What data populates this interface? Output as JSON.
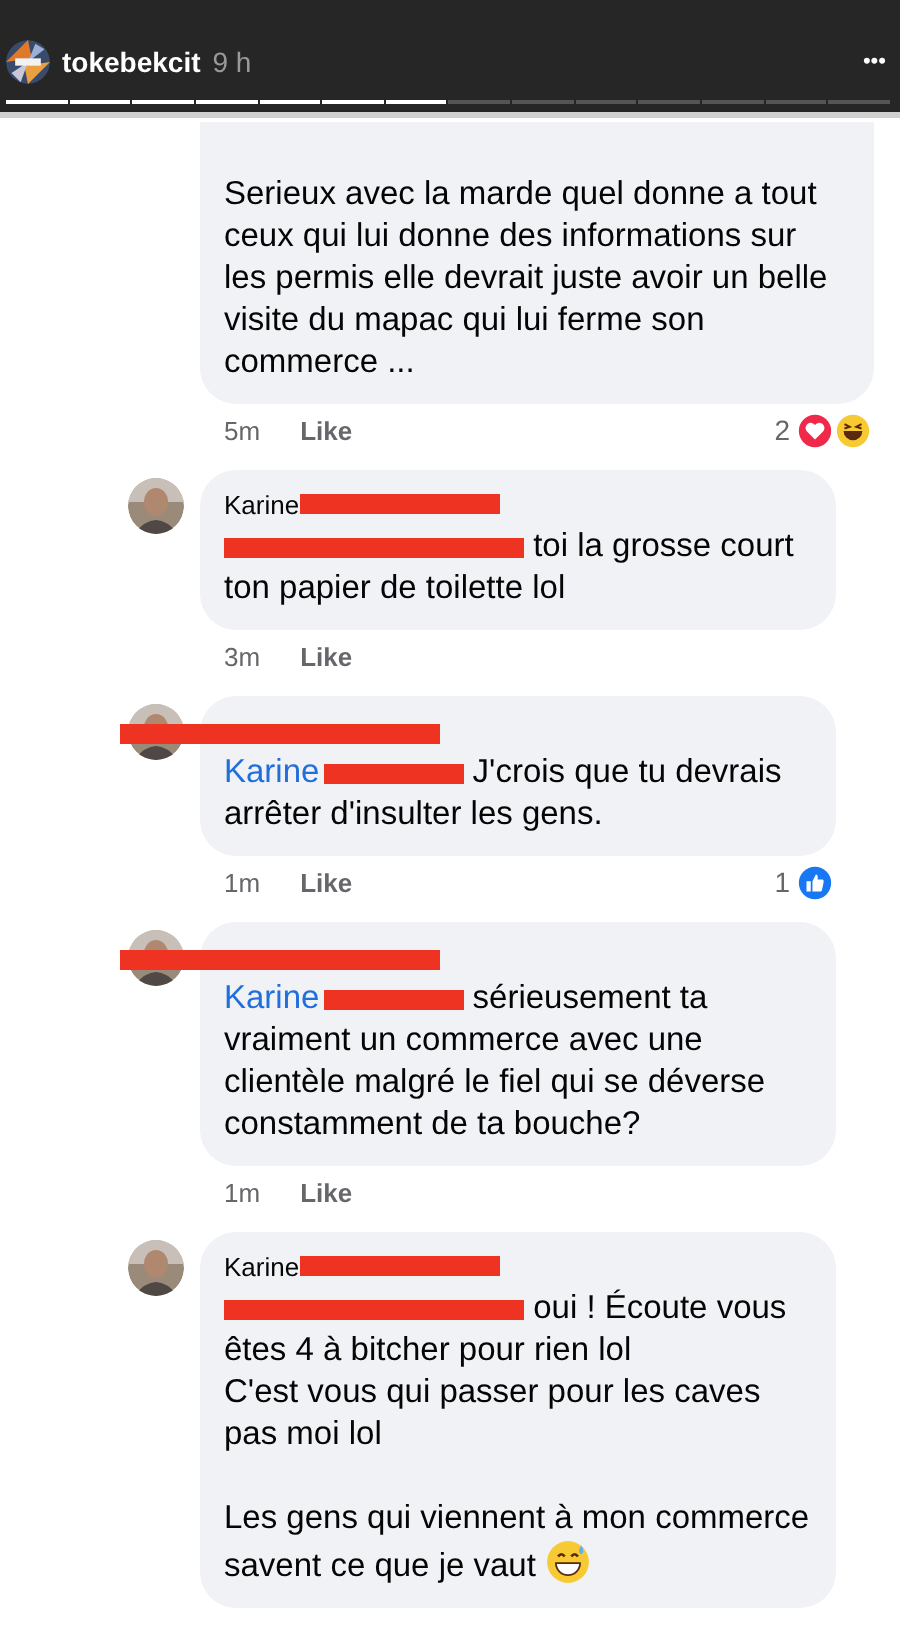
{
  "story_header": {
    "username": "tokebekcit",
    "time": "9 h",
    "menu": "•••",
    "progress": [
      {
        "level": 1
      },
      {
        "level": 1
      },
      {
        "level": 1
      },
      {
        "level": 1
      },
      {
        "level": 1
      },
      {
        "level": 1
      },
      {
        "level": 1
      },
      {
        "level": 0
      },
      {
        "level": 0
      },
      {
        "level": 0
      },
      {
        "level": 0
      },
      {
        "level": 0
      },
      {
        "level": 0
      },
      {
        "level": 0
      }
    ]
  },
  "comments": [
    {
      "avatar": false,
      "text": "Serieux avec la marde quel donne a tout ceux qui lui donne des informations sur les permis elle devrait juste avoir un belle visite du mapac qui lui ferme son commerce ...",
      "time": "5m",
      "like": "Like",
      "reactions": {
        "count": "2",
        "icons": [
          {
            "kind": "love"
          },
          {
            "kind": "haha"
          }
        ]
      }
    },
    {
      "avatar": true,
      "author": {
        "text": "Karine",
        "redacted": true
      },
      "mention": {
        "redacted": true
      },
      "text": "toi la grosse court ton papier de toilette lol",
      "time": "3m",
      "like": "Like"
    },
    {
      "avatar": true,
      "author": {
        "redacted": true
      },
      "mention": {
        "text": "Karine",
        "redacted": true
      },
      "text": "J'crois que tu devrais arrêter d'insulter les gens.",
      "time": "1m",
      "like": "Like",
      "reactions": {
        "count": "1",
        "icons": [
          {
            "kind": "like"
          }
        ]
      }
    },
    {
      "avatar": true,
      "author": {
        "redacted": true
      },
      "mention": {
        "text": "Karine",
        "redacted": true
      },
      "text": "sérieusement ta vraiment un commerce avec une clientèle malgré le fiel qui se déverse constamment de ta bouche?",
      "time": "1m",
      "like": "Like"
    },
    {
      "avatar": true,
      "author": {
        "text": "Karine",
        "redacted": true
      },
      "mention": {
        "redacted": true
      },
      "text": "oui ! Écoute vous êtes 4 à bitcher pour rien lol\nC'est vous qui passer pour les caves pas moi lol\n\nLes gens qui viennent à mon commerce savent ce que je vaut",
      "end_icon": {
        "kind": "grin_sweat"
      }
    }
  ]
}
